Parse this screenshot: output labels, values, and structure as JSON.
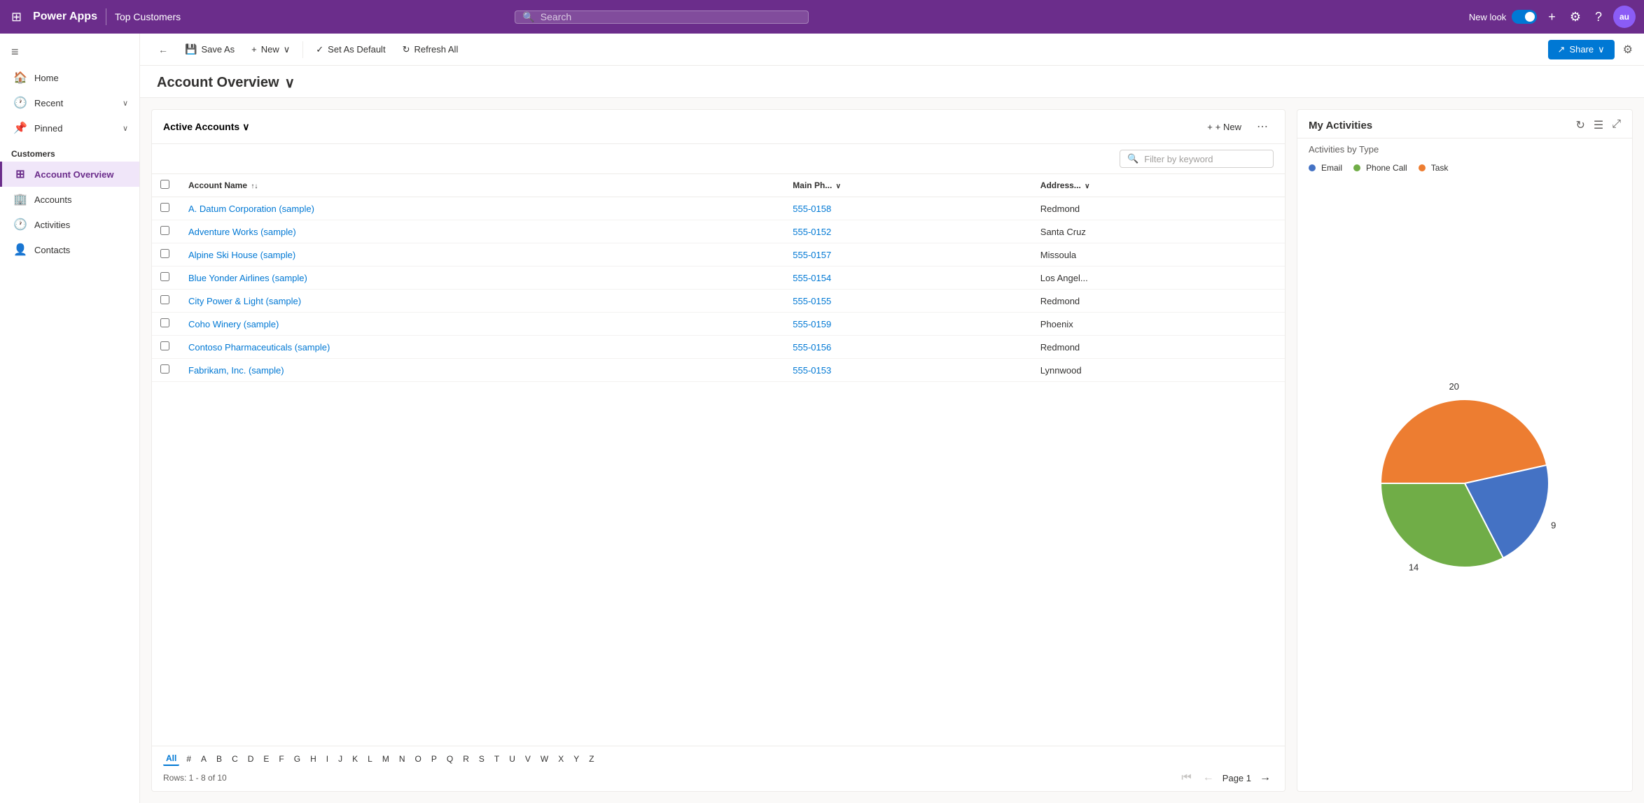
{
  "topbar": {
    "waffle_icon": "⊞",
    "app_name": "Power Apps",
    "divider": "|",
    "page_title": "Top Customers",
    "search_placeholder": "Search",
    "new_look_label": "New look",
    "plus_icon": "+",
    "settings_icon": "⚙",
    "help_icon": "?",
    "avatar_initials": "au"
  },
  "toolbar": {
    "back_icon": "←",
    "save_as_label": "Save As",
    "new_label": "New",
    "new_chevron": "∨",
    "set_default_label": "Set As Default",
    "refresh_label": "Refresh All",
    "share_label": "Share",
    "share_chevron": "∨"
  },
  "page": {
    "title": "Account Overview",
    "title_chevron": "∨"
  },
  "sidebar": {
    "hamburger": "≡",
    "items": [
      {
        "label": "Home",
        "icon": "🏠",
        "has_chevron": false
      },
      {
        "label": "Recent",
        "icon": "🕐",
        "has_chevron": true
      },
      {
        "label": "Pinned",
        "icon": "📌",
        "has_chevron": true
      }
    ],
    "section_label": "Customers",
    "nav_items": [
      {
        "label": "Account Overview",
        "icon": "⊞",
        "active": true
      },
      {
        "label": "Accounts",
        "icon": "🏢",
        "active": false
      },
      {
        "label": "Activities",
        "icon": "🕐",
        "active": false
      },
      {
        "label": "Contacts",
        "icon": "👤",
        "active": false
      }
    ]
  },
  "accounts_panel": {
    "title": "Active Accounts",
    "title_chevron": "∨",
    "new_btn": "+ New",
    "more_btn": "⋯",
    "filter_placeholder": "Filter by keyword",
    "filter_icon": "🔍",
    "columns": [
      {
        "id": "account_name",
        "label": "Account Name",
        "sort": "↑↓"
      },
      {
        "id": "main_phone",
        "label": "Main Ph... ∨"
      },
      {
        "id": "address",
        "label": "Address... ∨"
      }
    ],
    "rows": [
      {
        "id": 1,
        "name": "A. Datum Corporation (sample)",
        "phone": "555-0158",
        "address": "Redmond"
      },
      {
        "id": 2,
        "name": "Adventure Works (sample)",
        "phone": "555-0152",
        "address": "Santa Cruz"
      },
      {
        "id": 3,
        "name": "Alpine Ski House (sample)",
        "phone": "555-0157",
        "address": "Missoula"
      },
      {
        "id": 4,
        "name": "Blue Yonder Airlines (sample)",
        "phone": "555-0154",
        "address": "Los Angel..."
      },
      {
        "id": 5,
        "name": "City Power & Light (sample)",
        "phone": "555-0155",
        "address": "Redmond"
      },
      {
        "id": 6,
        "name": "Coho Winery (sample)",
        "phone": "555-0159",
        "address": "Phoenix"
      },
      {
        "id": 7,
        "name": "Contoso Pharmaceuticals (sample)",
        "phone": "555-0156",
        "address": "Redmond"
      },
      {
        "id": 8,
        "name": "Fabrikam, Inc. (sample)",
        "phone": "555-0153",
        "address": "Lynnwood"
      }
    ],
    "alpha_nav": [
      "All",
      "#",
      "A",
      "B",
      "C",
      "D",
      "E",
      "F",
      "G",
      "H",
      "I",
      "J",
      "K",
      "L",
      "M",
      "N",
      "O",
      "P",
      "Q",
      "R",
      "S",
      "T",
      "U",
      "V",
      "W",
      "X",
      "Y",
      "Z"
    ],
    "rows_info": "Rows: 1 - 8 of 10",
    "page_label": "Page 1"
  },
  "activities_panel": {
    "title": "My Activities",
    "subtitle": "Activities by Type",
    "refresh_icon": "↻",
    "list_icon": "☰",
    "expand_icon": "⤢",
    "legend": [
      {
        "label": "Email",
        "color": "#4472c4"
      },
      {
        "label": "Phone Call",
        "color": "#70ad47"
      },
      {
        "label": "Task",
        "color": "#ed7d31"
      }
    ],
    "chart": {
      "email_value": 9,
      "phone_value": 14,
      "task_value": 20,
      "email_pct": 20.9,
      "phone_pct": 32.6,
      "task_pct": 46.5
    }
  }
}
